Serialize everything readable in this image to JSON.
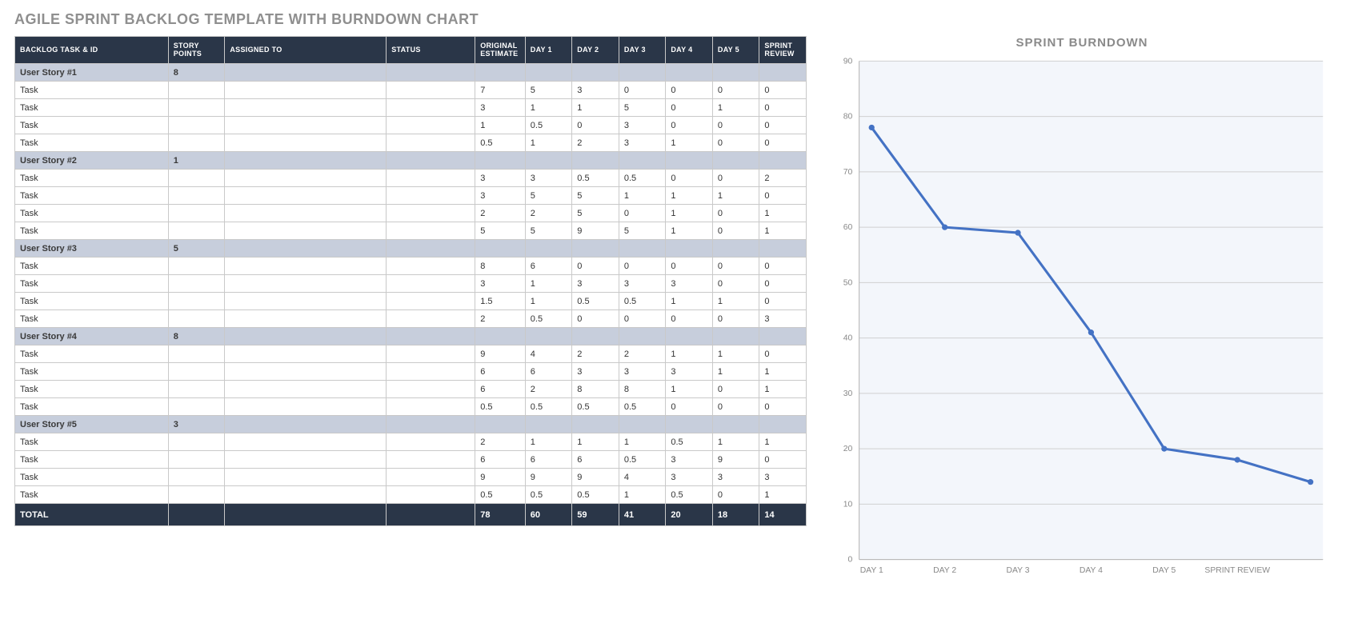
{
  "page_title": "AGILE SPRINT BACKLOG TEMPLATE WITH BURNDOWN CHART",
  "table": {
    "headers": {
      "task_id": "BACKLOG TASK & ID",
      "points": "STORY POINTS",
      "assigned": "ASSIGNED TO",
      "status": "STATUS",
      "estimate": "ORIGINAL ESTIMATE",
      "day1": "DAY 1",
      "day2": "DAY 2",
      "day3": "DAY 3",
      "day4": "DAY 4",
      "day5": "DAY 5",
      "review": "SPRINT REVIEW"
    },
    "stories": [
      {
        "name": "User Story #1",
        "points": "8",
        "tasks": [
          {
            "name": "Task",
            "est": "7",
            "d1": "5",
            "d2": "3",
            "d3": "0",
            "d4": "0",
            "d5": "0",
            "rev": "0"
          },
          {
            "name": "Task",
            "est": "3",
            "d1": "1",
            "d2": "1",
            "d3": "5",
            "d4": "0",
            "d5": "1",
            "rev": "0"
          },
          {
            "name": "Task",
            "est": "1",
            "d1": "0.5",
            "d2": "0",
            "d3": "3",
            "d4": "0",
            "d5": "0",
            "rev": "0"
          },
          {
            "name": "Task",
            "est": "0.5",
            "d1": "1",
            "d2": "2",
            "d3": "3",
            "d4": "1",
            "d5": "0",
            "rev": "0"
          }
        ]
      },
      {
        "name": "User Story #2",
        "points": "1",
        "tasks": [
          {
            "name": "Task",
            "est": "3",
            "d1": "3",
            "d2": "0.5",
            "d3": "0.5",
            "d4": "0",
            "d5": "0",
            "rev": "2"
          },
          {
            "name": "Task",
            "est": "3",
            "d1": "5",
            "d2": "5",
            "d3": "1",
            "d4": "1",
            "d5": "1",
            "rev": "0"
          },
          {
            "name": "Task",
            "est": "2",
            "d1": "2",
            "d2": "5",
            "d3": "0",
            "d4": "1",
            "d5": "0",
            "rev": "1"
          },
          {
            "name": "Task",
            "est": "5",
            "d1": "5",
            "d2": "9",
            "d3": "5",
            "d4": "1",
            "d5": "0",
            "rev": "1"
          }
        ]
      },
      {
        "name": "User Story #3",
        "points": "5",
        "tasks": [
          {
            "name": "Task",
            "est": "8",
            "d1": "6",
            "d2": "0",
            "d3": "0",
            "d4": "0",
            "d5": "0",
            "rev": "0"
          },
          {
            "name": "Task",
            "est": "3",
            "d1": "1",
            "d2": "3",
            "d3": "3",
            "d4": "3",
            "d5": "0",
            "rev": "0"
          },
          {
            "name": "Task",
            "est": "1.5",
            "d1": "1",
            "d2": "0.5",
            "d3": "0.5",
            "d4": "1",
            "d5": "1",
            "rev": "0"
          },
          {
            "name": "Task",
            "est": "2",
            "d1": "0.5",
            "d2": "0",
            "d3": "0",
            "d4": "0",
            "d5": "0",
            "rev": "3"
          }
        ]
      },
      {
        "name": "User Story #4",
        "points": "8",
        "tasks": [
          {
            "name": "Task",
            "est": "9",
            "d1": "4",
            "d2": "2",
            "d3": "2",
            "d4": "1",
            "d5": "1",
            "rev": "0"
          },
          {
            "name": "Task",
            "est": "6",
            "d1": "6",
            "d2": "3",
            "d3": "3",
            "d4": "3",
            "d5": "1",
            "rev": "1"
          },
          {
            "name": "Task",
            "est": "6",
            "d1": "2",
            "d2": "8",
            "d3": "8",
            "d4": "1",
            "d5": "0",
            "rev": "1"
          },
          {
            "name": "Task",
            "est": "0.5",
            "d1": "0.5",
            "d2": "0.5",
            "d3": "0.5",
            "d4": "0",
            "d5": "0",
            "rev": "0"
          }
        ]
      },
      {
        "name": "User Story #5",
        "points": "3",
        "tasks": [
          {
            "name": "Task",
            "est": "2",
            "d1": "1",
            "d2": "1",
            "d3": "1",
            "d4": "0.5",
            "d5": "1",
            "rev": "1"
          },
          {
            "name": "Task",
            "est": "6",
            "d1": "6",
            "d2": "6",
            "d3": "0.5",
            "d4": "3",
            "d5": "9",
            "rev": "0"
          },
          {
            "name": "Task",
            "est": "9",
            "d1": "9",
            "d2": "9",
            "d3": "4",
            "d4": "3",
            "d5": "3",
            "rev": "3"
          },
          {
            "name": "Task",
            "est": "0.5",
            "d1": "0.5",
            "d2": "0.5",
            "d3": "1",
            "d4": "0.5",
            "d5": "0",
            "rev": "1"
          }
        ]
      }
    ],
    "total": {
      "label": "TOTAL",
      "est": "78",
      "d1": "60",
      "d2": "59",
      "d3": "41",
      "d4": "20",
      "d5": "18",
      "rev": "14"
    }
  },
  "chart_data": {
    "type": "line",
    "title": "SPRINT BURNDOWN",
    "categories": [
      "DAY 1",
      "DAY 2",
      "DAY 3",
      "DAY 4",
      "DAY 5",
      "SPRINT REVIEW"
    ],
    "values": [
      78,
      60,
      59,
      41,
      20,
      18,
      14
    ],
    "ylim": [
      0,
      90
    ],
    "ystep": 10,
    "xlabel": "",
    "ylabel": ""
  }
}
